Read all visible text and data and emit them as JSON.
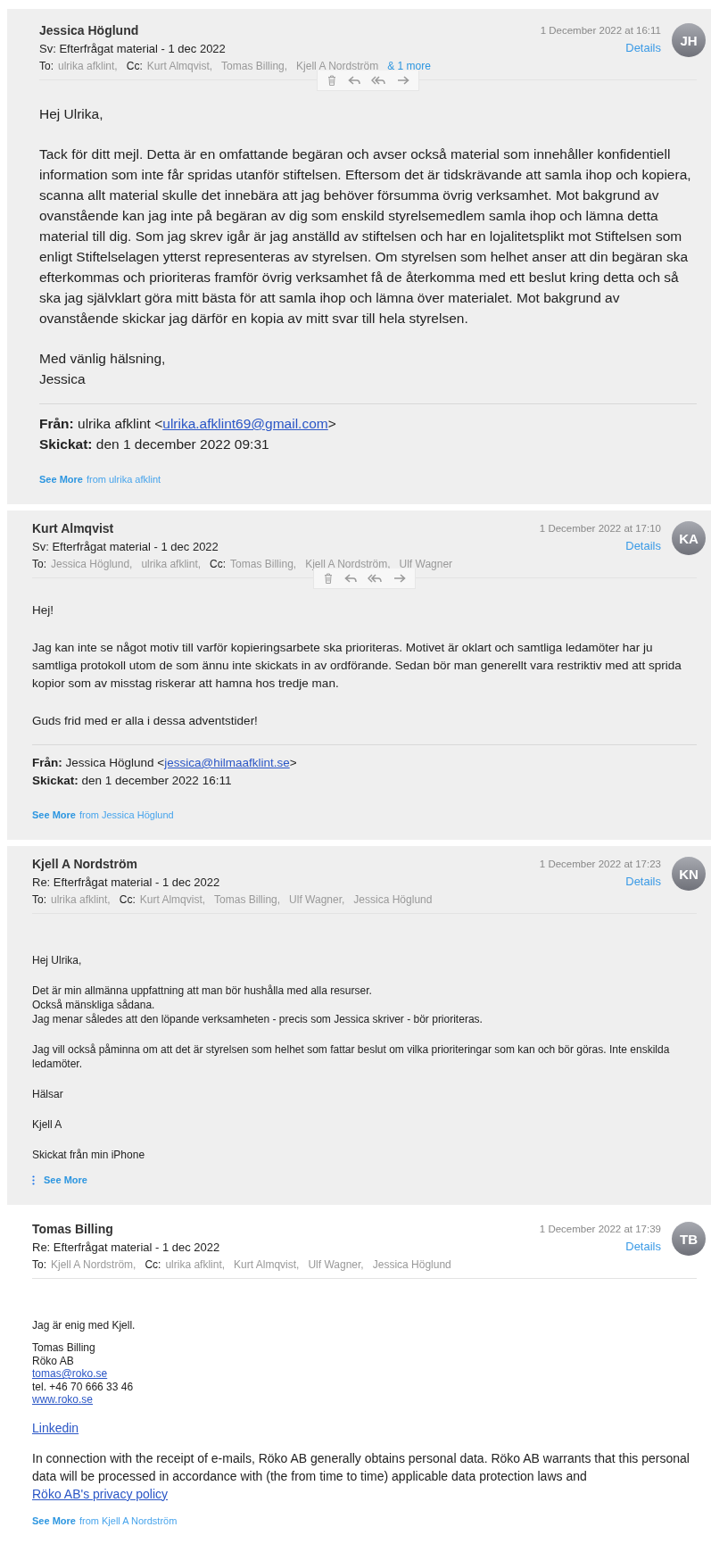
{
  "messages": [
    {
      "sender": "Jessica Höglund",
      "date": "1 December 2022 at 16:11",
      "details": "Details",
      "initials": "JH",
      "subject": "Sv: Efterfrågat material - 1 dec 2022",
      "shaded": true,
      "to_label": "To:",
      "to": [
        "ulrika afklint,"
      ],
      "cc_label": "Cc:",
      "cc": [
        "Kurt Almqvist,",
        "Tomas Billing,",
        "Kjell A Nordström"
      ],
      "more": "& 1 more",
      "toolbar": true,
      "body": [
        {
          "kind": "text-large",
          "lines": [
            "Hej Ulrika,"
          ]
        },
        {
          "kind": "text-large",
          "lines": [
            "Tack för ditt mejl. Detta är en omfattande begäran och avser också material som innehåller konfidentiell information som inte får spridas utanför stiftelsen. Eftersom det är tidskrävande att samla ihop och kopiera, scanna allt material skulle det innebära att jag behöver försumma övrig verksamhet. Mot bakgrund av ovanstående kan jag inte på begäran av dig som enskild styrelsemedlem samla ihop och lämna detta material till dig. Som jag skrev igår är jag anställd av stiftelsen och har en lojalitetsplikt mot Stiftelsen som enligt Stiftelselagen ytterst representeras av styrelsen. Om styrelsen som helhet anser att din begäran ska efterkommas och prioriteras framför övrig verksamhet få de återkomma med ett beslut kring detta och så ska jag självklart göra mitt bästa för att samla ihop och lämna över materialet. Mot bakgrund av ovanstående skickar jag därför en kopia av mitt svar till hela styrelsen."
          ]
        },
        {
          "kind": "text-large",
          "lines": [
            "Med vänlig hälsning,",
            "Jessica"
          ]
        },
        {
          "kind": "rule"
        },
        {
          "kind": "text-large",
          "lines": [
            [
              {
                "text": "**Från:** ulrika afklint <"
              },
              {
                "text": "ulrika.afklint69@gmail.com",
                "link": true
              },
              {
                "text": ">"
              }
            ],
            "**Skickat:** den 1 december 2022 09:31"
          ]
        },
        {
          "kind": "see_more",
          "label": "See More",
          "from": "from ulrika afklint",
          "dots": false
        }
      ]
    },
    {
      "sender": "Kurt Almqvist",
      "date": "1 December 2022 at 17:10",
      "details": "Details",
      "initials": "KA",
      "subject": "Sv: Efterfrågat material - 1 dec 2022",
      "shaded": true,
      "to_label": "To:",
      "to": [
        "Jessica Höglund,",
        "ulrika afklint,"
      ],
      "cc_label": "Cc:",
      "cc": [
        "Tomas Billing,",
        "Kjell A Nordström,",
        "Ulf Wagner"
      ],
      "toolbar": true,
      "body": [
        {
          "kind": "text-medium",
          "lines": [
            "Hej!"
          ]
        },
        {
          "kind": "text-medium",
          "lines": [
            "Jag kan inte se något motiv till varför kopieringsarbete ska prioriteras. Motivet är oklart och samtliga ledamöter har ju samtliga protokoll utom de som ännu inte skickats in av ordförande. Sedan bör man generellt vara restriktiv med att sprida kopior som av misstag riskerar att hamna hos tredje man."
          ]
        },
        {
          "kind": "text-medium",
          "lines": [
            "Guds frid med er alla i dessa adventstider!"
          ]
        },
        {
          "kind": "rule"
        },
        {
          "kind": "text-medium",
          "lines": [
            [
              {
                "text": "**Från:** Jessica Höglund <"
              },
              {
                "text": "jessica@hilmaafklint.se",
                "link": true
              },
              {
                "text": ">"
              }
            ],
            "**Skickat:** den 1 december 2022 16:11"
          ]
        },
        {
          "kind": "see_more",
          "label": "See More",
          "from": "from Jessica Höglund",
          "dots": false
        }
      ]
    },
    {
      "sender": "Kjell A Nordström",
      "date": "1 December 2022 at 17:23",
      "details": "Details",
      "initials": "KN",
      "subject": "Re: Efterfrågat material - 1 dec 2022",
      "shaded": true,
      "to_label": "To:",
      "to": [
        "ulrika afklint,"
      ],
      "cc_label": "Cc:",
      "cc": [
        "Kurt Almqvist,",
        "Tomas Billing,",
        "Ulf Wagner,",
        "Jessica Höglund"
      ],
      "toolbar": false,
      "body": [
        {
          "kind": "text",
          "lines": [
            "Hej Ulrika,"
          ]
        },
        {
          "kind": "text",
          "lines": [
            "Det är min allmänna uppfattning att man bör hushålla med alla resurser.",
            "Också mänskliga sådana.",
            "Jag menar således att den löpande verksamheten - precis som Jessica skriver - bör prioriteras."
          ]
        },
        {
          "kind": "text",
          "lines": [
            "Jag vill också påminna om att det är styrelsen som helhet som fattar beslut om vilka prioriteringar som kan och bör göras. Inte enskilda ledamöter."
          ]
        },
        {
          "kind": "text",
          "lines": [
            "Hälsar"
          ]
        },
        {
          "kind": "text",
          "lines": [
            "Kjell A"
          ]
        },
        {
          "kind": "text",
          "lines": [
            "Skickat från min iPhone"
          ]
        },
        {
          "kind": "see_more",
          "label": "See More",
          "dots": true
        }
      ]
    },
    {
      "sender": "Tomas Billing",
      "date": "1 December 2022 at 17:39",
      "details": "Details",
      "initials": "TB",
      "subject": "Re: Efterfrågat material - 1 dec 2022",
      "shaded": false,
      "to_label": "To:",
      "to": [
        "Kjell A Nordström,"
      ],
      "cc_label": "Cc:",
      "cc": [
        "ulrika afklint,",
        "Kurt Almqvist,",
        "Ulf Wagner,",
        "Jessica Höglund"
      ],
      "toolbar": false,
      "body": [
        {
          "kind": "text",
          "lines": [
            "Jag är enig med Kjell."
          ]
        },
        {
          "kind": "signature",
          "lines": [
            "Tomas Billing",
            "Röko AB",
            [
              {
                "text": "tomas@roko.se",
                "link": true
              }
            ],
            "tel. +46 70 666 33 46",
            [
              {
                "text": "www.roko.se",
                "link": true
              }
            ]
          ]
        },
        {
          "kind": "text-medium",
          "lines": [
            [
              {
                "text": "Linkedin",
                "link": true
              }
            ]
          ]
        },
        {
          "kind": "text-medium",
          "lines": [
            [
              {
                "text": "In connection with the receipt of e-mails, Röko AB generally obtains personal data. Röko AB warrants that this personal data will be processed in accordance with (the from time to time) applicable data protection laws and "
              },
              {
                "text": "Röko AB's privacy policy",
                "link": true
              }
            ]
          ]
        },
        {
          "kind": "see_more",
          "label": "See More",
          "from": "from Kjell A Nordström",
          "dots": false
        }
      ]
    }
  ]
}
